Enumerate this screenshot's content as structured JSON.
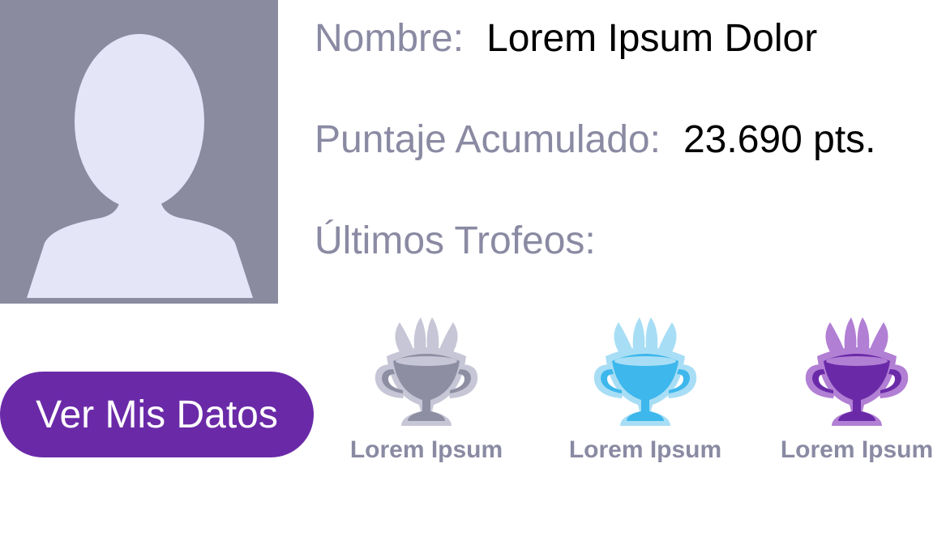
{
  "profile": {
    "name_label": "Nombre:",
    "name_value": "Lorem Ipsum Dolor",
    "score_label": "Puntaje Acumulado:",
    "score_value": "23.690 pts.",
    "trophies_label": "Últimos Trofeos:"
  },
  "button": {
    "label": "Ver Mis Datos"
  },
  "trophies": [
    {
      "label": "Lorem Ipsum",
      "color": "#8e8ea3",
      "halo": "#c6c6d6"
    },
    {
      "label": "Lorem Ipsum",
      "color": "#3db7ec",
      "halo": "#a8def5"
    },
    {
      "label": "Lorem Ipsum",
      "color": "#6a2aa8",
      "halo": "#b17fd4"
    }
  ],
  "colors": {
    "avatar_bg": "#8b8ba0",
    "avatar_fg": "#e5e5f8",
    "accent": "#6a2aa8",
    "label": "#8a8aa3"
  },
  "icons": {
    "avatar": "user-silhouette-icon",
    "trophy": "trophy-icon"
  }
}
